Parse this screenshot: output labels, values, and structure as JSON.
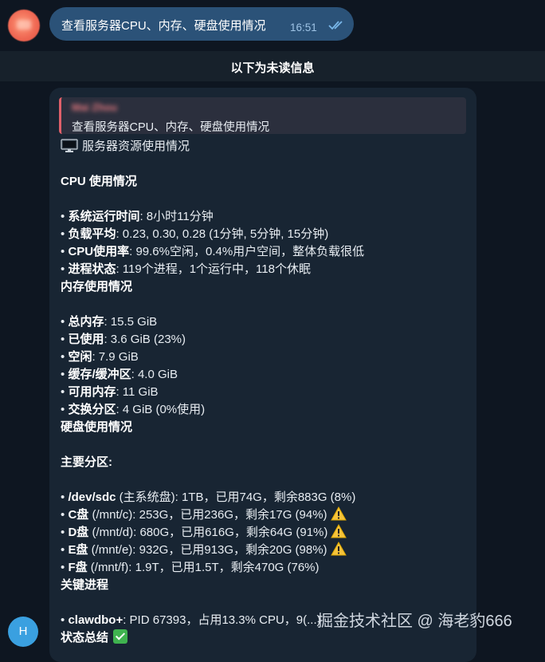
{
  "outgoing": {
    "text": "查看服务器CPU、内存、硬盘使用情况",
    "time": "16:51"
  },
  "unread_label": "以下为未读信息",
  "reply": {
    "quote_name": "Mai Zhou",
    "quote_text": "查看服务器CPU、内存、硬盘使用情况"
  },
  "message": {
    "title": "服务器资源使用情况",
    "cpu_heading": "CPU 使用情况",
    "cpu": [
      {
        "label": "系统运行时间",
        "value": ": 8小时11分钟"
      },
      {
        "label": "负载平均",
        "value": ": 0.23, 0.30, 0.28 (1分钟, 5分钟, 15分钟)"
      },
      {
        "label": "CPU使用率",
        "value": ": 99.6%空闲，0.4%用户空间，整体负载很低"
      },
      {
        "label": "进程状态",
        "value": ": 119个进程，1个运行中，118个休眠"
      }
    ],
    "mem_heading": "内存使用情况",
    "mem": [
      {
        "label": "总内存",
        "value": ": 15.5 GiB"
      },
      {
        "label": "已使用",
        "value": ": 3.6 GiB (23%)"
      },
      {
        "label": "空闲",
        "value": ": 7.9 GiB"
      },
      {
        "label": "缓存/缓冲区",
        "value": ": 4.0 GiB"
      },
      {
        "label": "可用内存",
        "value": ": 11 GiB"
      },
      {
        "label": "交换分区",
        "value": ": 4 GiB (0%使用)"
      }
    ],
    "disk_heading": "硬盘使用情况",
    "partitions_heading": "主要分区:",
    "disks": [
      {
        "label": "/dev/sdc",
        "value": " (主系统盘): 1TB，已用74G，剩余883G (8%)"
      },
      {
        "label": "C盘",
        "value": " (/mnt/c): 253G，已用236G，剩余17G (94%)"
      },
      {
        "label": "D盘",
        "value": " (/mnt/d): 680G，已用616G，剩余64G (91%)"
      },
      {
        "label": "E盘",
        "value": " (/mnt/e): 932G，已用913G，剩余20G (98%)"
      },
      {
        "label": "F盘",
        "value": " (/mnt/f): 1.9T，已用1.5T，剩余470G (76%)"
      }
    ],
    "proc_heading": "关键进程",
    "proc": {
      "label": "clawdbo+",
      "value": ": PID 67393，占用13.3% CPU，9(...)"
    },
    "summary": "状态总结"
  },
  "bullet": "•",
  "sender_initial": "H",
  "watermark": "掘金技术社区 @ 海老豹666"
}
